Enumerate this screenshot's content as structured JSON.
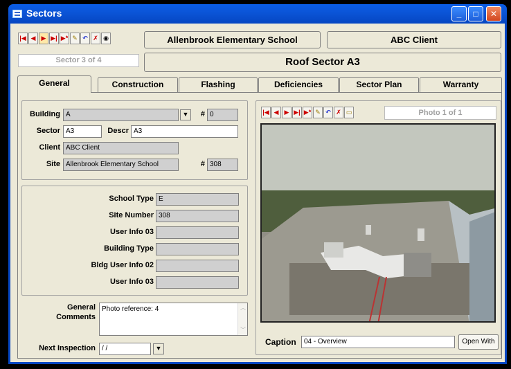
{
  "window": {
    "title": "Sectors"
  },
  "top": {
    "school": "Allenbrook Elementary School",
    "client": "ABC Client",
    "sector_counter": "Sector 3 of 4",
    "sector_title": "Roof Sector A3"
  },
  "tabs": [
    "General",
    "Construction",
    "Flashing",
    "Deficiencies",
    "Sector Plan",
    "Warranty"
  ],
  "general": {
    "building_label": "Building",
    "building_value": "A",
    "hash_label": "#",
    "building_num": "0",
    "sector_label": "Sector",
    "sector_value": "A3",
    "descr_label": "Descr",
    "descr_value": "A3",
    "client_label": "Client",
    "client_value": "ABC Client",
    "site_label": "Site",
    "site_value": "Allenbrook Elementary School",
    "site_num": "308",
    "school_type_label": "School Type",
    "school_type_value": "E",
    "site_number_label": "Site Number",
    "site_number_value": "308",
    "user_info_03_label": "User Info 03",
    "user_info_03_value": "",
    "building_type_label": "Building Type",
    "building_type_value": "",
    "bldg_user_info_02_label": "Bldg User Info 02",
    "bldg_user_info_02_value": "",
    "user_info_03b_label": "User Info 03",
    "user_info_03b_value": "",
    "general_comments_label_1": "General",
    "general_comments_label_2": "Comments",
    "comments_value": "Photo reference:  4",
    "next_inspection_label": "Next Inspection",
    "next_inspection_value": " / /"
  },
  "photo": {
    "counter": "Photo  1 of 1",
    "caption_label": "Caption",
    "caption_value": "04 - Overview",
    "open_with": "Open With"
  },
  "icons": {
    "first": "first-record-icon",
    "prev": "prev-record-icon",
    "next": "next-record-icon",
    "last": "last-record-icon",
    "new": "new-record-icon",
    "save": "save-icon",
    "undo": "undo-icon",
    "delete": "delete-icon",
    "find": "binoculars-icon",
    "open": "folder-open-icon"
  },
  "colors": {
    "titlebar": "#0b55d8",
    "face": "#ece9d8",
    "readonly": "#d0d0d0"
  }
}
